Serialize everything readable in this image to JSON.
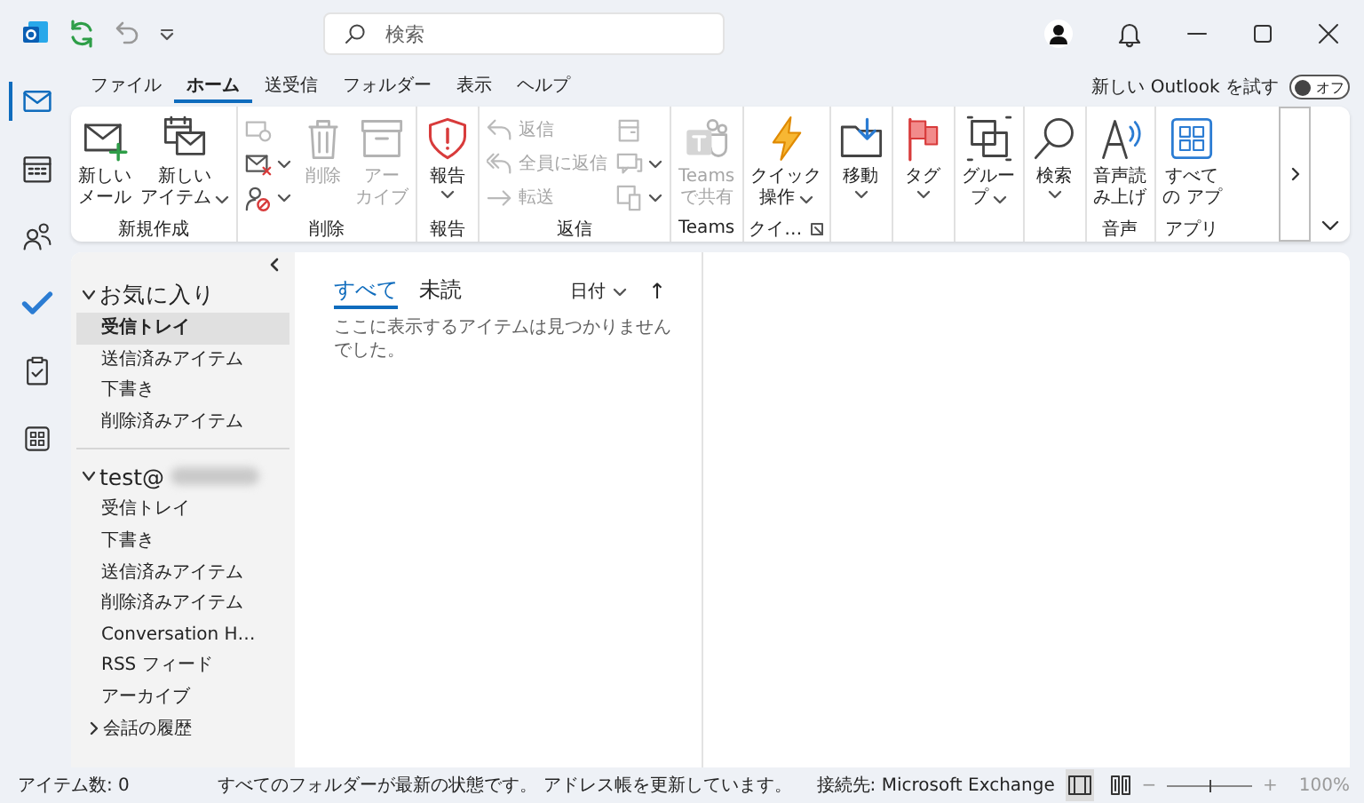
{
  "title_bar": {
    "search": {
      "placeholder": "検索"
    }
  },
  "nav": [
    {
      "selected": true
    },
    {
      "selected": false
    },
    {
      "selected": false
    },
    {
      "selected": false
    },
    {
      "selected": false
    },
    {
      "selected": false
    }
  ],
  "menu_tabs": [
    {
      "label": "ファイル",
      "selected": false
    },
    {
      "label": "ホーム",
      "selected": true
    },
    {
      "label": "送受信",
      "selected": false
    },
    {
      "label": "フォルダー",
      "selected": false
    },
    {
      "label": "表示",
      "selected": false
    },
    {
      "label": "ヘルプ",
      "selected": false
    }
  ],
  "new_outlook": {
    "label": "新しい Outlook を試す",
    "toggle": "オフ",
    "on": false
  },
  "ribbon": {
    "groups": [
      {
        "label": "新規作成",
        "launcher": false,
        "items": [
          {
            "kind": "large",
            "lines": [
              "新しい",
              "メール"
            ],
            "caret": false,
            "disabled": false
          },
          {
            "kind": "large",
            "lines": [
              "新しい",
              "アイテム"
            ],
            "caret": true,
            "disabled": false
          }
        ]
      },
      {
        "label": "削除",
        "launcher": false,
        "items": [
          {
            "kind": "stack",
            "buttons": [
              {
                "caret": false,
                "disabled": true
              },
              {
                "caret": true,
                "disabled": false
              },
              {
                "caret": true,
                "disabled": false
              }
            ]
          },
          {
            "kind": "large",
            "lines": [
              "削除"
            ],
            "caret": false,
            "disabled": true
          },
          {
            "kind": "large",
            "lines": [
              "アー",
              "カイブ"
            ],
            "caret": false,
            "disabled": true
          }
        ]
      },
      {
        "label": "報告",
        "launcher": false,
        "items": [
          {
            "kind": "large",
            "lines": [
              "報告"
            ],
            "caret": true,
            "disabled": false
          }
        ]
      },
      {
        "label": "返信",
        "launcher": false,
        "items": [
          {
            "kind": "stack",
            "buttons": [
              {
                "label": "返信",
                "caret": false,
                "disabled": true
              },
              {
                "label": "全員に返信",
                "caret": false,
                "disabled": true
              },
              {
                "label": "転送",
                "caret": false,
                "disabled": true
              }
            ]
          },
          {
            "kind": "stack",
            "buttons": [
              {
                "caret": false,
                "disabled": true
              },
              {
                "caret": true,
                "disabled": true
              },
              {
                "caret": true,
                "disabled": true
              }
            ]
          }
        ]
      },
      {
        "label": "Teams",
        "launcher": false,
        "items": [
          {
            "kind": "large",
            "lines": [
              "Teams",
              "で共有"
            ],
            "caret": false,
            "disabled": true
          }
        ]
      },
      {
        "label": "クイ…",
        "launcher": true,
        "items": [
          {
            "kind": "large",
            "lines": [
              "クイック",
              "操作"
            ],
            "caret": true,
            "disabled": false
          }
        ]
      },
      {
        "launcher": false,
        "items": [
          {
            "kind": "large",
            "lines": [
              "移動"
            ],
            "caret": true,
            "disabled": false
          }
        ]
      },
      {
        "launcher": false,
        "items": [
          {
            "kind": "large",
            "lines": [
              "タグ"
            ],
            "caret": true,
            "disabled": false
          }
        ]
      },
      {
        "launcher": false,
        "items": [
          {
            "kind": "large",
            "lines": [
              "グルー",
              "プ"
            ],
            "caret": true,
            "disabled": false
          }
        ]
      },
      {
        "launcher": false,
        "items": [
          {
            "kind": "large",
            "lines": [
              "検索"
            ],
            "caret": true,
            "disabled": false
          }
        ]
      },
      {
        "label": "音声",
        "launcher": false,
        "items": [
          {
            "kind": "large",
            "lines": [
              "音声読",
              "み上げ"
            ],
            "caret": false,
            "disabled": false
          }
        ]
      },
      {
        "label": "アプリ",
        "launcher": false,
        "items": [
          {
            "kind": "large",
            "lines": [
              "すべて",
              "の アプ"
            ],
            "caret": false,
            "disabled": false
          }
        ]
      }
    ]
  },
  "folder_pane": {
    "sections": [
      {
        "name": "お気に入り",
        "expanded": true,
        "blurred": false,
        "folders": [
          {
            "name": "受信トレイ",
            "kind": "folder",
            "selected": true
          },
          {
            "name": "送信済みアイテム",
            "kind": "folder",
            "selected": false
          },
          {
            "name": "下書き",
            "kind": "folder",
            "selected": false
          },
          {
            "name": "削除済みアイテム",
            "kind": "folder",
            "selected": false
          }
        ]
      },
      {
        "name": "test@",
        "expanded": true,
        "blurred": true,
        "folders": [
          {
            "name": "受信トレイ",
            "kind": "folder",
            "selected": false
          },
          {
            "name": "下書き",
            "kind": "folder",
            "selected": false
          },
          {
            "name": "送信済みアイテム",
            "kind": "folder",
            "selected": false
          },
          {
            "name": "削除済みアイテム",
            "kind": "folder",
            "selected": false
          },
          {
            "name": "Conversation H…",
            "kind": "folder",
            "selected": false
          },
          {
            "name": "RSS フィード",
            "kind": "folder",
            "selected": false
          },
          {
            "name": "アーカイブ",
            "kind": "folder",
            "selected": false
          },
          {
            "name": "会話の履歴",
            "kind": "collapsed",
            "selected": false
          }
        ]
      }
    ]
  },
  "message_list": {
    "tabs": [
      {
        "label": "すべて",
        "selected": true
      },
      {
        "label": "未読",
        "selected": false
      }
    ],
    "sort": "日付",
    "sort_direction": "↑",
    "empty_text": "ここに表示するアイテムは見つかりませんでした。"
  },
  "status_bar": {
    "item_count": "アイテム数: 0",
    "message": "すべてのフォルダーが最新の状態です。 アドレス帳を更新しています。",
    "connection": "接続先: Microsoft Exchange",
    "views": [
      {
        "selected": true
      },
      {
        "selected": false
      }
    ],
    "zoom_minus": "−",
    "zoom_plus": "+",
    "zoom": {
      "level": 0.5
    },
    "zoom_text": "100%"
  }
}
